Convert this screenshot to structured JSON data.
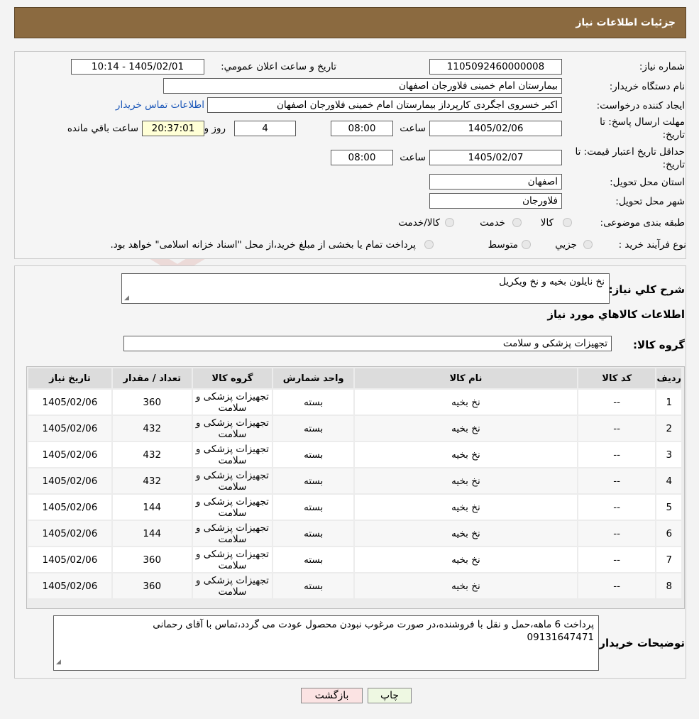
{
  "header": {
    "title": "جزئیات اطلاعات نیاز"
  },
  "form": {
    "need_number_label": "شماره نیاز:",
    "need_number": "1105092460000008",
    "announce_label": "تاریخ و ساعت اعلان عمومي:",
    "announce_value": "1405/02/01 - 10:14",
    "buyer_label": "نام دستگاه خريدار:",
    "buyer_value": "بیمارستان امام خمینی فلاورجان اصفهان",
    "creator_label": "ايجاد کننده درخواست:",
    "creator_value": "اکبر خسروی اجگردی کارپرداز بیمارستان امام خمینی فلاورجان اصفهان",
    "contact_link": "اطلاعات تماس خريدار",
    "deadline_label_1": "مهلت ارسال پاسخ: تا",
    "deadline_label_2": "تاريخ:",
    "deadline_date": "1405/02/06",
    "time_label": "ساعت",
    "deadline_time": "08:00",
    "days_value": "4",
    "days_label": "روز و",
    "remaining_time": "20:37:01",
    "remaining_label": "ساعت باقي مانده",
    "min_validity_label_1": "حداقل تاريخ اعتبار قيمت: تا",
    "min_validity_label_2": "تاريخ:",
    "validity_date": "1405/02/07",
    "validity_time": "08:00",
    "province_label": "استان محل تحويل:",
    "province_value": "اصفهان",
    "city_label": "شهر محل تحويل:",
    "city_value": "فلاورجان",
    "category_label": "طبقه بندی موضوعی:",
    "category_options": [
      "کالا",
      "خدمت",
      "کالا/خدمت"
    ],
    "process_label": "نوع فرآيند خريد :",
    "process_options": [
      "جزيي",
      "متوسط"
    ],
    "process_note": "پرداخت تمام يا بخشی از مبلغ خريد،از محل \"اسناد خزانه اسلامی\" خواهد بود."
  },
  "details": {
    "summary_label": "شرح كلي نياز:",
    "summary_value": "نخ نایلون بخیه و نخ ویکریل",
    "goods_info_title": "اطلاعات کالاهاي مورد نياز",
    "group_label": "گروه کالا:",
    "group_value": "تجهیزات پزشکی و سلامت"
  },
  "table": {
    "headers": [
      "رديف",
      "کد کالا",
      "نام کالا",
      "واحد شمارش",
      "گروه کالا",
      "تعداد / مقدار",
      "تاريخ نياز"
    ],
    "rows": [
      [
        "1",
        "--",
        "نخ بخیه",
        "بسته",
        "تجهیزات پزشکی و سلامت",
        "360",
        "1405/02/06"
      ],
      [
        "2",
        "--",
        "نخ بخیه",
        "بسته",
        "تجهیزات پزشکی و سلامت",
        "432",
        "1405/02/06"
      ],
      [
        "3",
        "--",
        "نخ بخیه",
        "بسته",
        "تجهیزات پزشکی و سلامت",
        "432",
        "1405/02/06"
      ],
      [
        "4",
        "--",
        "نخ بخیه",
        "بسته",
        "تجهیزات پزشکی و سلامت",
        "432",
        "1405/02/06"
      ],
      [
        "5",
        "--",
        "نخ بخیه",
        "بسته",
        "تجهیزات پزشکی و سلامت",
        "144",
        "1405/02/06"
      ],
      [
        "6",
        "--",
        "نخ بخیه",
        "بسته",
        "تجهیزات پزشکی و سلامت",
        "144",
        "1405/02/06"
      ],
      [
        "7",
        "--",
        "نخ بخیه",
        "بسته",
        "تجهیزات پزشکی و سلامت",
        "360",
        "1405/02/06"
      ],
      [
        "8",
        "--",
        "نخ بخیه",
        "بسته",
        "تجهیزات پزشکی و سلامت",
        "360",
        "1405/02/06"
      ]
    ]
  },
  "buyer_notes": {
    "label": "توضيحات خريدار:",
    "line1": "پرداخت 6 ماهه،حمل و نقل با فروشنده،در صورت مرغوب نبودن محصول عودت می گردد،تماس با آقای رحمانی",
    "line2": "09131647471"
  },
  "buttons": {
    "print": "چاپ",
    "back": "بازگشت"
  },
  "watermark": {
    "text": "AriaTender.neT",
    "color": "#c0392b"
  }
}
